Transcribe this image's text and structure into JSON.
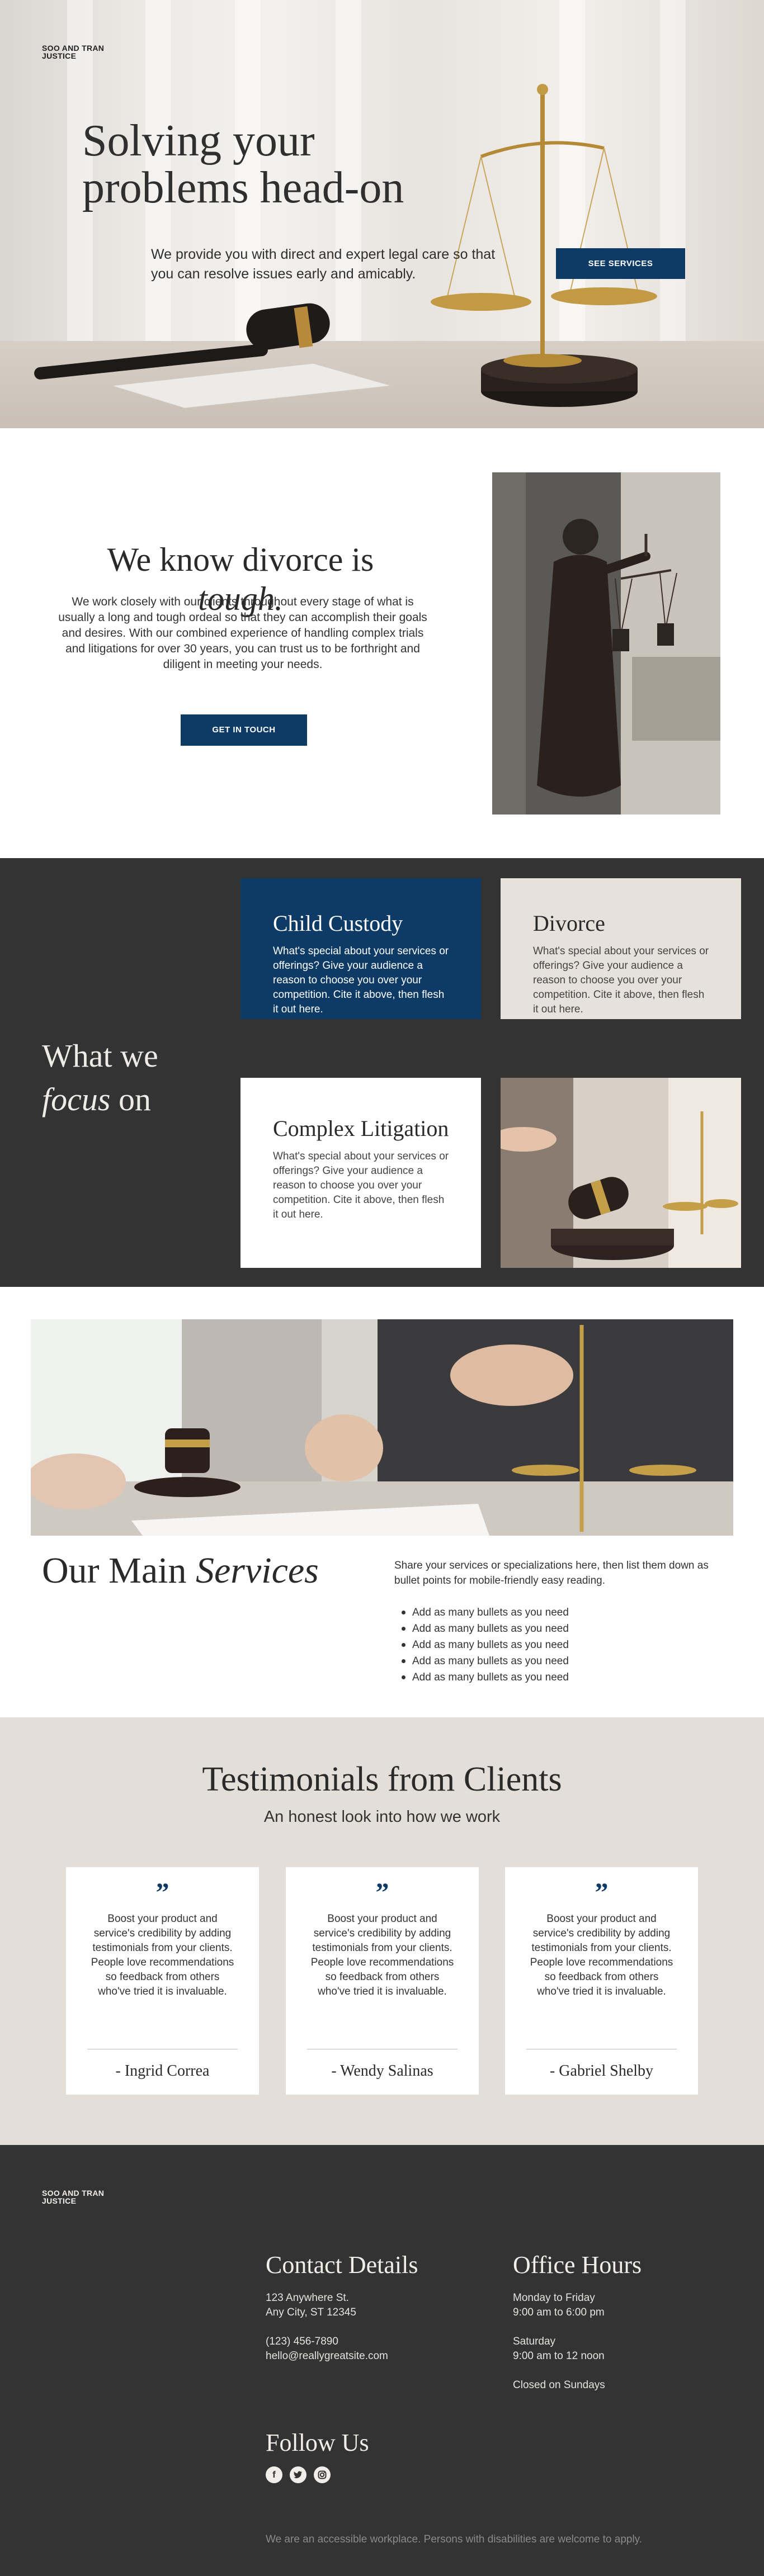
{
  "brand": {
    "line1": "SOO AND TRAN",
    "line2": "JUSTICE"
  },
  "hero": {
    "title_line1": "Solving your",
    "title_line2": "problems head-on",
    "subtitle": "We provide you with direct and expert legal care so that you can resolve issues early and amicably.",
    "cta_label": "SEE SERVICES"
  },
  "about": {
    "title_lead": "We know divorce is ",
    "title_emphasis": "tough.",
    "body": "We work closely with our clients throughout every stage of what is usually a long and tough ordeal so that they can accomplish their goals and desires. With our combined experience of handling complex trials and litigations for over 30 years, you can trust us to be forthright and diligent in meeting your needs.",
    "cta_label": "GET IN TOUCH"
  },
  "focus": {
    "title_line1": "What we",
    "title_emphasis": "focus",
    "title_tail": " on",
    "cards": [
      {
        "title": "Child Custody",
        "text": "What's special about your services or offerings? Give your audience a reason to choose you over your competition. Cite it above, then flesh it out here."
      },
      {
        "title": "Divorce",
        "text": "What's special about your services or offerings? Give your audience a reason to choose you over your competition. Cite it above, then flesh it out here."
      },
      {
        "title": "Complex Litigation",
        "text": "What's special about your services or offerings? Give your audience a reason to choose you over your competition. Cite it above, then flesh it out here."
      }
    ]
  },
  "services": {
    "title_lead": "Our Main ",
    "title_emphasis": "Services",
    "intro": "Share your services or specializations here, then list them down as bullet points for mobile-friendly easy reading.",
    "bullets": [
      "Add as many bullets as you need",
      "Add as many bullets as you need",
      "Add as many bullets as you need",
      "Add as many bullets as you need",
      "Add as many bullets as you need"
    ]
  },
  "testimonials": {
    "title": "Testimonials from Clients",
    "subtitle": "An honest look into how we work",
    "items": [
      {
        "quote_mark": "”",
        "text": "Boost your product and service's credibility by adding testimonials from your clients. People love recommendations so feedback from others who've tried it is invaluable.",
        "name": "- Ingrid Correa"
      },
      {
        "quote_mark": "”",
        "text": "Boost your product and service's credibility by adding testimonials from your clients. People love recommendations so feedback from others who've tried it is invaluable.",
        "name": "- Wendy Salinas"
      },
      {
        "quote_mark": "”",
        "text": "Boost your product and service's credibility by adding testimonials from your clients. People love recommendations so feedback from others who've tried it is invaluable.",
        "name": "- Gabriel Shelby"
      }
    ]
  },
  "footer": {
    "contact": {
      "heading": "Contact Details",
      "address1": "123 Anywhere St.",
      "address2": "Any City, ST 12345",
      "phone": "(123) 456-7890",
      "email": "hello@reallygreatsite.com"
    },
    "hours": {
      "heading": "Office Hours",
      "weekday_label": "Monday to Friday",
      "weekday_hours": "9:00 am to 6:00 pm",
      "saturday_label": "Saturday",
      "saturday_hours": "9:00 am to 12 noon",
      "sunday": "Closed on Sundays"
    },
    "follow": {
      "heading": "Follow Us",
      "icons": [
        "facebook-icon",
        "twitter-icon",
        "instagram-icon"
      ]
    },
    "note": "We are an accessible workplace. Persons with disabilities are welcome to apply."
  },
  "colors": {
    "navy": "#0e3b66",
    "charcoal": "#333333",
    "beige": "#e3ded7",
    "card_beige": "#e6e1da"
  }
}
